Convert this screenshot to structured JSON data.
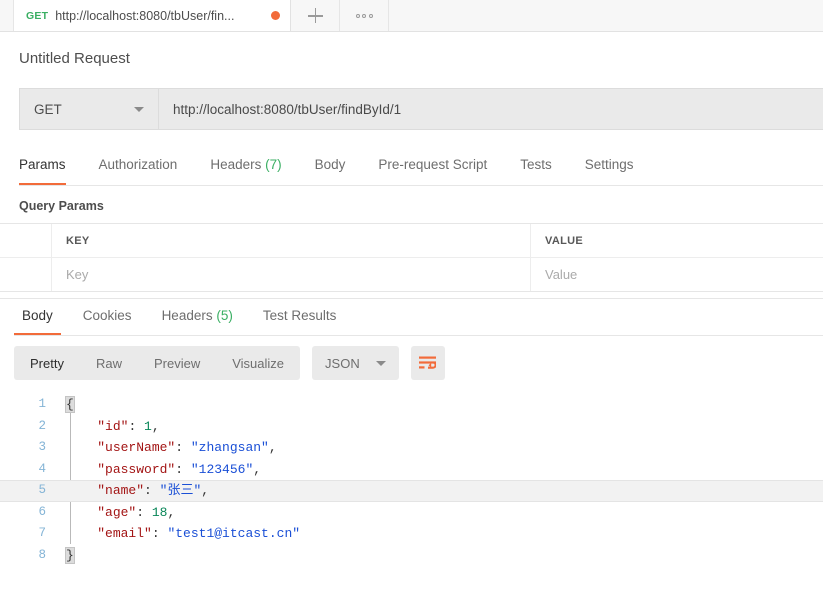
{
  "tab_bar": {
    "tabs": [
      {
        "method": "GET",
        "url": "http://localhost:8080/tbUser/fin...",
        "unsaved": true
      }
    ],
    "new_tab_icon": "plus-icon",
    "more_icon": "dots-horizontal-icon"
  },
  "request": {
    "title": "Untitled Request",
    "method": "GET",
    "url": "http://localhost:8080/tbUser/findById/1",
    "tabs": [
      {
        "label": "Params",
        "count": "",
        "active": true
      },
      {
        "label": "Authorization",
        "count": "",
        "active": false
      },
      {
        "label": "Headers",
        "count": "(7)",
        "active": false
      },
      {
        "label": "Body",
        "count": "",
        "active": false
      },
      {
        "label": "Pre-request Script",
        "count": "",
        "active": false
      },
      {
        "label": "Tests",
        "count": "",
        "active": false
      },
      {
        "label": "Settings",
        "count": "",
        "active": false
      }
    ],
    "query_params": {
      "section_label": "Query Params",
      "headers": {
        "key": "KEY",
        "value": "VALUE"
      },
      "rows": [
        {
          "key_placeholder": "Key",
          "value_placeholder": "Value"
        }
      ]
    }
  },
  "response": {
    "tabs": [
      {
        "label": "Body",
        "count": "",
        "active": true
      },
      {
        "label": "Cookies",
        "count": "",
        "active": false
      },
      {
        "label": "Headers",
        "count": "(5)",
        "active": false
      },
      {
        "label": "Test Results",
        "count": "",
        "active": false
      }
    ],
    "view_modes": [
      {
        "label": "Pretty",
        "active": true
      },
      {
        "label": "Raw",
        "active": false
      },
      {
        "label": "Preview",
        "active": false
      },
      {
        "label": "Visualize",
        "active": false
      }
    ],
    "format": "JSON",
    "wrap_icon": "word-wrap-icon",
    "body_lines": [
      {
        "n": "1",
        "active": false,
        "tokens": [
          {
            "t": "brace",
            "v": "{"
          }
        ]
      },
      {
        "n": "2",
        "active": false,
        "tokens": [
          {
            "t": "pun",
            "v": "    "
          },
          {
            "t": "k",
            "v": "\"id\""
          },
          {
            "t": "pun",
            "v": ": "
          },
          {
            "t": "num",
            "v": "1"
          },
          {
            "t": "pun",
            "v": ","
          }
        ]
      },
      {
        "n": "3",
        "active": false,
        "tokens": [
          {
            "t": "pun",
            "v": "    "
          },
          {
            "t": "k",
            "v": "\"userName\""
          },
          {
            "t": "pun",
            "v": ": "
          },
          {
            "t": "str",
            "v": "\"zhangsan\""
          },
          {
            "t": "pun",
            "v": ","
          }
        ]
      },
      {
        "n": "4",
        "active": false,
        "tokens": [
          {
            "t": "pun",
            "v": "    "
          },
          {
            "t": "k",
            "v": "\"password\""
          },
          {
            "t": "pun",
            "v": ": "
          },
          {
            "t": "str",
            "v": "\"123456\""
          },
          {
            "t": "pun",
            "v": ","
          }
        ]
      },
      {
        "n": "5",
        "active": true,
        "tokens": [
          {
            "t": "pun",
            "v": "    "
          },
          {
            "t": "k",
            "v": "\"name\""
          },
          {
            "t": "pun",
            "v": ": "
          },
          {
            "t": "str",
            "v": "\"张三\""
          },
          {
            "t": "pun",
            "v": ","
          }
        ]
      },
      {
        "n": "6",
        "active": false,
        "tokens": [
          {
            "t": "pun",
            "v": "    "
          },
          {
            "t": "k",
            "v": "\"age\""
          },
          {
            "t": "pun",
            "v": ": "
          },
          {
            "t": "num",
            "v": "18"
          },
          {
            "t": "pun",
            "v": ","
          }
        ]
      },
      {
        "n": "7",
        "active": false,
        "tokens": [
          {
            "t": "pun",
            "v": "    "
          },
          {
            "t": "k",
            "v": "\"email\""
          },
          {
            "t": "pun",
            "v": ": "
          },
          {
            "t": "str",
            "v": "\"test1@itcast.cn\""
          }
        ]
      },
      {
        "n": "8",
        "active": false,
        "tokens": [
          {
            "t": "brace",
            "v": "}"
          }
        ]
      }
    ]
  },
  "colors": {
    "accent": "#f26b3a",
    "success": "#3aaf63",
    "json_key": "#a31515",
    "json_string": "#1a4fd6",
    "json_number": "#098658",
    "line_number": "#84b4d6"
  }
}
